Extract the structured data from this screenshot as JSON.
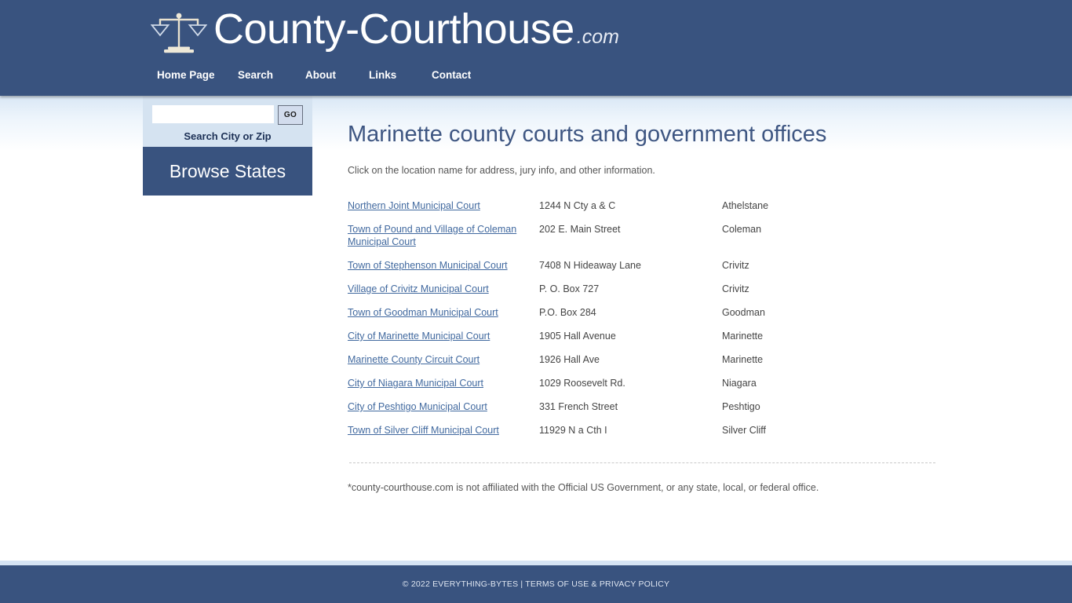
{
  "header": {
    "logo_icon": "scales-of-justice-icon",
    "brand_name": "County-Courthouse",
    "brand_tld": ".com",
    "nav": [
      {
        "label": "Home Page"
      },
      {
        "label": "Search"
      },
      {
        "label": "About"
      },
      {
        "label": "Links"
      },
      {
        "label": "Contact"
      }
    ]
  },
  "sidebar": {
    "search": {
      "value": "",
      "placeholder": "",
      "go_label": "GO",
      "caption": "Search City or Zip"
    },
    "browse_states_label": "Browse States"
  },
  "main": {
    "title": "Marinette county courts and government offices",
    "intro": "Click on the location name for address, jury info, and other information.",
    "rows": [
      {
        "name": "Northern Joint Municipal Court",
        "address": "1244 N Cty a & C",
        "city": "Athelstane"
      },
      {
        "name": "Town of Pound and Village of Coleman Municipal Court",
        "address": "202 E. Main Street",
        "city": "Coleman"
      },
      {
        "name": "Town of Stephenson Municipal Court",
        "address": "7408 N Hideaway Lane",
        "city": "Crivitz"
      },
      {
        "name": "Village of Crivitz Municipal Court",
        "address": "P. O. Box 727",
        "city": "Crivitz"
      },
      {
        "name": "Town of Goodman Municipal Court",
        "address": "P.O. Box 284",
        "city": "Goodman"
      },
      {
        "name": "City of Marinette Municipal Court",
        "address": "1905 Hall Avenue",
        "city": "Marinette"
      },
      {
        "name": "Marinette County Circuit Court",
        "address": "1926 Hall Ave",
        "city": "Marinette"
      },
      {
        "name": "City of Niagara Municipal Court",
        "address": "1029 Roosevelt Rd.",
        "city": "Niagara"
      },
      {
        "name": "City of Peshtigo Municipal Court",
        "address": "331 French Street",
        "city": "Peshtigo"
      },
      {
        "name": "Town of Silver Cliff Municipal Court",
        "address": "11929 N a Cth I",
        "city": "Silver Cliff"
      }
    ],
    "disclaimer": "*county-courthouse.com is not affiliated with the Official US Government, or any state, local, or federal office."
  },
  "footer": {
    "copyright": "© 2022 EVERYTHING-BYTES | ",
    "terms_label": "TERMS OF USE & PRIVACY POLICY"
  },
  "colors": {
    "brand_blue": "#39537f",
    "panel_blue": "#d5e3f1",
    "link_blue": "#41699f",
    "heading_blue": "#3e5682",
    "body_text": "#555555"
  }
}
